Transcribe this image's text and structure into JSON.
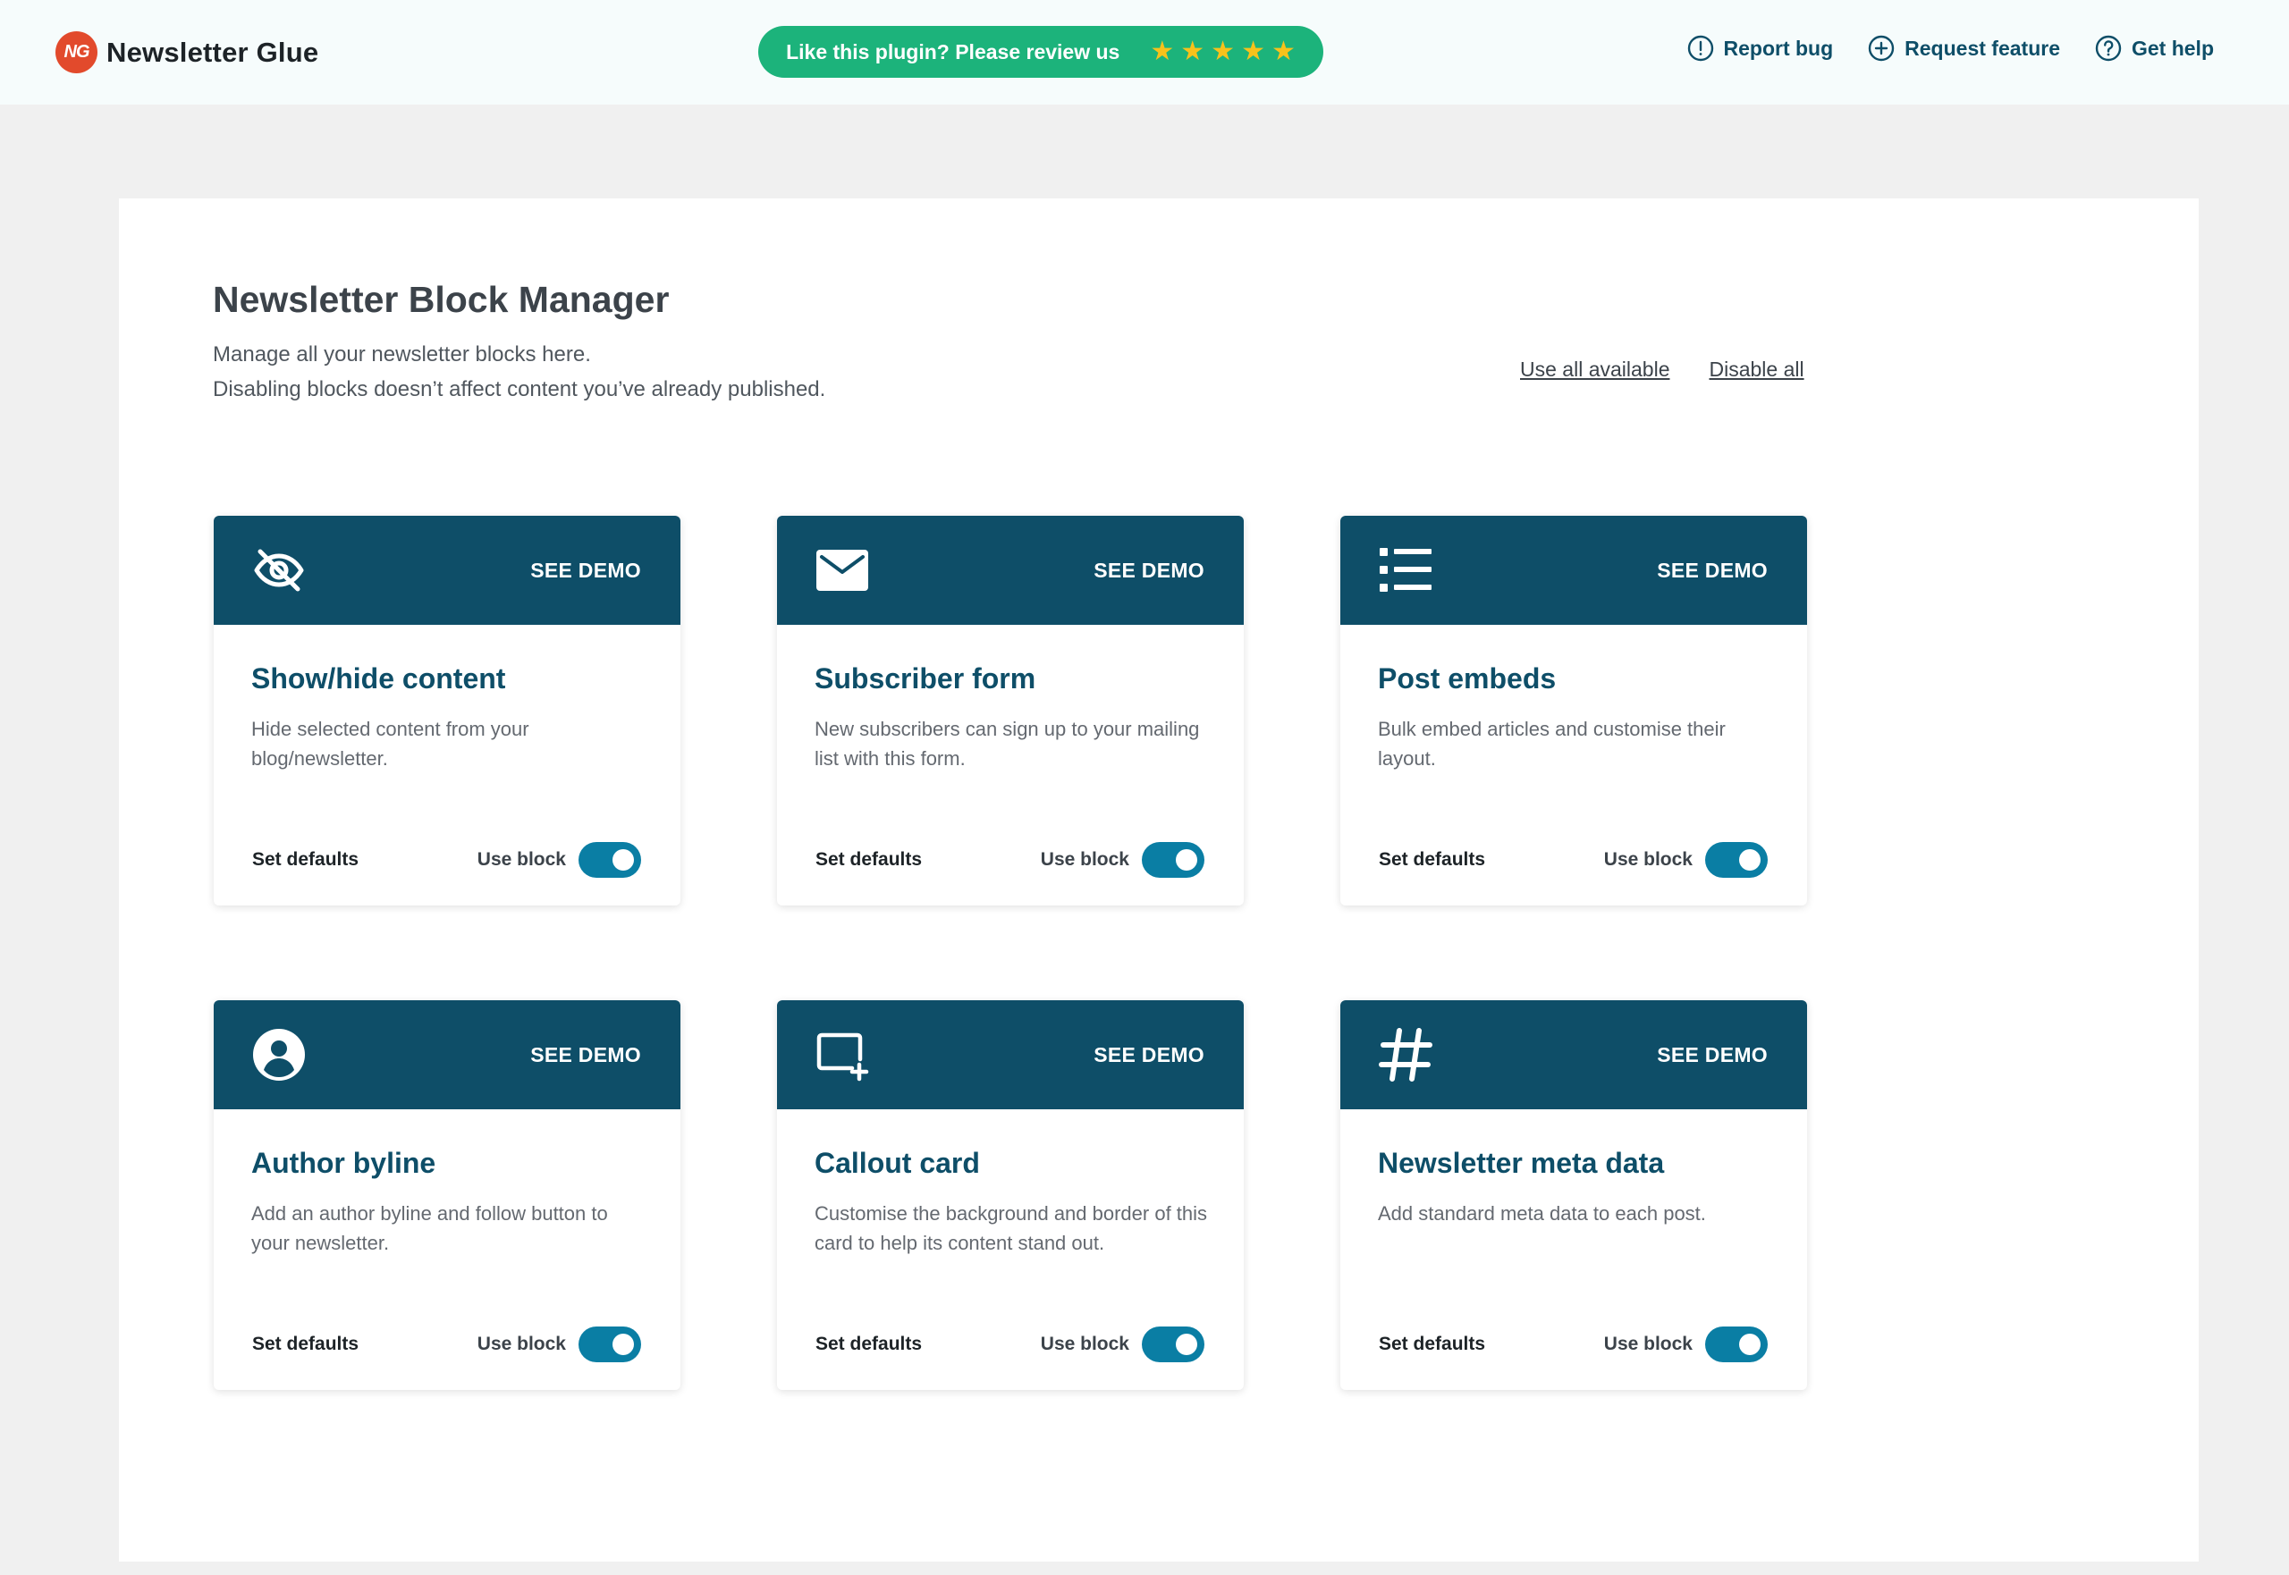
{
  "header": {
    "brand_logo_text": "NG",
    "brand_name": "Newsletter Glue",
    "review_text": "Like this plugin? Please review us",
    "rating_stars": 5,
    "links": [
      {
        "label": "Report bug",
        "icon": "alert-circle-icon"
      },
      {
        "label": "Request feature",
        "icon": "plus-circle-icon"
      },
      {
        "label": "Get help",
        "icon": "help-circle-icon"
      }
    ]
  },
  "main": {
    "title": "Newsletter Block Manager",
    "description_line1": "Manage all your newsletter blocks here.",
    "description_line2": "Disabling blocks doesn’t affect content you’ve already published.",
    "use_all_label": "Use all available",
    "disable_all_label": "Disable all"
  },
  "cards": [
    {
      "icon": "eye-off-icon",
      "demo_label": "SEE DEMO",
      "title": "Show/hide content",
      "description": "Hide selected content from your blog/newsletter.",
      "defaults_label": "Set defaults",
      "use_label": "Use block",
      "enabled": true
    },
    {
      "icon": "envelope-icon",
      "demo_label": "SEE DEMO",
      "title": "Subscriber form",
      "description": "New subscribers can sign up to your mailing list with this form.",
      "defaults_label": "Set defaults",
      "use_label": "Use block",
      "enabled": true
    },
    {
      "icon": "list-icon",
      "demo_label": "SEE DEMO",
      "title": "Post embeds",
      "description": "Bulk embed articles and customise their layout.",
      "defaults_label": "Set defaults",
      "use_label": "Use block",
      "enabled": true
    },
    {
      "icon": "user-circle-icon",
      "demo_label": "SEE DEMO",
      "title": "Author byline",
      "description": "Add an author byline and follow button to your newsletter.",
      "defaults_label": "Set defaults",
      "use_label": "Use block",
      "enabled": true
    },
    {
      "icon": "card-add-icon",
      "demo_label": "SEE DEMO",
      "title": "Callout card",
      "description": "Customise the background and border of this card to help its content stand out.",
      "defaults_label": "Set defaults",
      "use_label": "Use block",
      "enabled": true
    },
    {
      "icon": "hashtag-icon",
      "demo_label": "SEE DEMO",
      "title": "Newsletter meta data",
      "description": "Add standard meta data to each post.",
      "defaults_label": "Set defaults",
      "use_label": "Use block",
      "enabled": true
    }
  ],
  "colors": {
    "brand_red": "#e24a2c",
    "review_green": "#1cb37b",
    "star_yellow": "#f7c21b",
    "primary_teal": "#0e4e68",
    "toggle_blue": "#0a7ea4"
  }
}
